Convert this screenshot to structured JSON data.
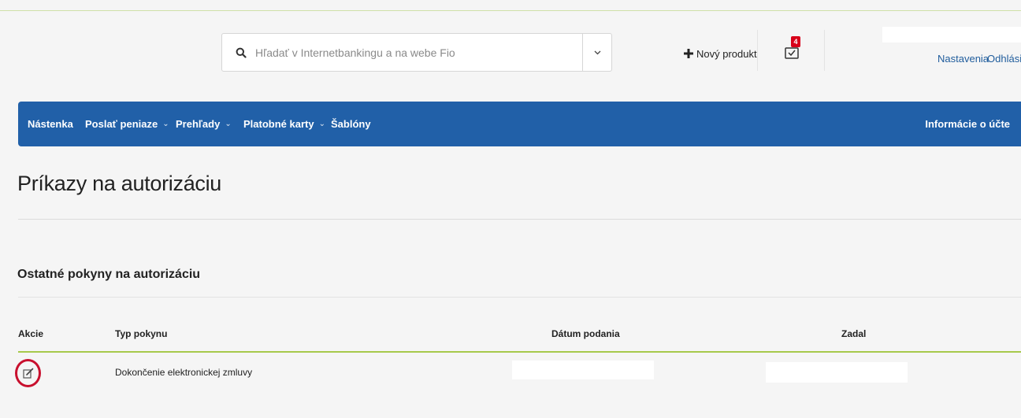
{
  "header": {
    "search": {
      "placeholder": "Hľadať v Internetbankingu a na webe Fio",
      "value": ""
    },
    "new_product_label": "Nový produkt",
    "mail_badge_count": "4",
    "settings_label": "Nastavenia",
    "logout_label": "Odhlásiť"
  },
  "nav": {
    "items": [
      {
        "label": "Nástenka",
        "has_dropdown": false
      },
      {
        "label": "Poslať peniaze",
        "has_dropdown": true
      },
      {
        "label": "Prehľady",
        "has_dropdown": true
      },
      {
        "label": "Platobné karty",
        "has_dropdown": true
      },
      {
        "label": "Šablóny",
        "has_dropdown": false
      }
    ],
    "account_info_label": "Informácie o účte"
  },
  "main": {
    "page_title": "Príkazy na autorizáciu",
    "section_title": "Ostatné pokyny na autorizáciu",
    "table": {
      "columns": [
        "Akcie",
        "Typ pokynu",
        "Dátum podania",
        "Zadal"
      ],
      "rows": [
        {
          "type": "Dokončenie elektronickej zmluvy",
          "date": "",
          "entered_by": ""
        }
      ]
    }
  },
  "colors": {
    "nav_background": "#2160a8",
    "link": "#1f5c9c",
    "badge": "#d8001a",
    "highlight_circle": "#c8102e",
    "table_rule": "#a6c94b"
  },
  "icons": {
    "search": "search-icon",
    "dropdown": "chevron-down-icon",
    "new_product": "plus-icon",
    "mail": "envelope-check-icon",
    "row_action": "edit-icon"
  }
}
